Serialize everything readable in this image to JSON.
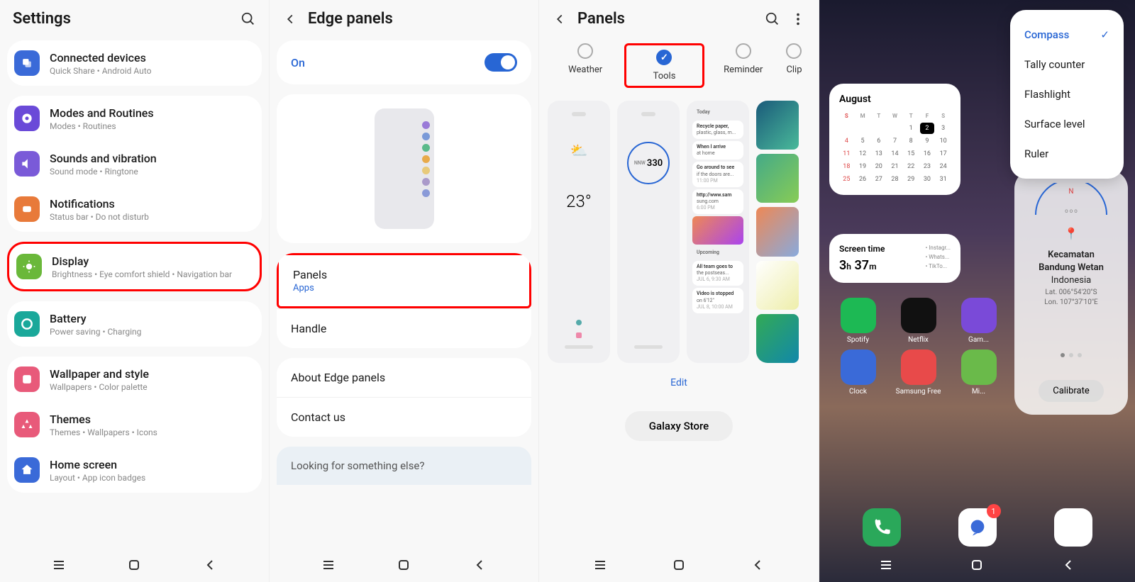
{
  "screen1": {
    "title": "Settings",
    "items": [
      {
        "title": "Connected devices",
        "subtitle": "Quick Share • Android Auto",
        "icon": "link-icon",
        "color": "#3a6ad8"
      },
      {
        "title": "Modes and Routines",
        "subtitle": "Modes • Routines",
        "icon": "modes-icon",
        "color": "#6a4ad8"
      },
      {
        "title": "Sounds and vibration",
        "subtitle": "Sound mode • Ringtone",
        "icon": "sound-icon",
        "color": "#7a5ad8"
      },
      {
        "title": "Notifications",
        "subtitle": "Status bar • Do not disturb",
        "icon": "notif-icon",
        "color": "#e87a3a"
      },
      {
        "title": "Display",
        "subtitle": "Brightness • Eye comfort shield • Navigation bar",
        "icon": "display-icon",
        "color": "#6ab83a"
      },
      {
        "title": "Battery",
        "subtitle": "Power saving • Charging",
        "icon": "battery-icon",
        "color": "#1aa89a"
      },
      {
        "title": "Wallpaper and style",
        "subtitle": "Wallpapers • Color palette",
        "icon": "wallpaper-icon",
        "color": "#e85a7a"
      },
      {
        "title": "Themes",
        "subtitle": "Themes • Wallpapers • Icons",
        "icon": "themes-icon",
        "color": "#e85a7a"
      },
      {
        "title": "Home screen",
        "subtitle": "Layout • App icon badges",
        "icon": "home-icon",
        "color": "#3a6ad8"
      }
    ]
  },
  "screen2": {
    "title": "Edge panels",
    "toggle_label": "On",
    "items": [
      {
        "title": "Panels",
        "sub": "Apps"
      },
      {
        "title": "Handle"
      },
      {
        "title": "About Edge panels"
      },
      {
        "title": "Contact us"
      }
    ],
    "footer": "Looking for something else?"
  },
  "screen3": {
    "title": "Panels",
    "tabs": [
      {
        "label": "Weather",
        "checked": false
      },
      {
        "label": "Tools",
        "checked": true
      },
      {
        "label": "Reminder",
        "checked": false
      },
      {
        "label": "Clip",
        "checked": false
      }
    ],
    "weather_temp": "23°",
    "compass_val": "330",
    "compass_prefix": "NNW",
    "reminders": [
      {
        "title": "Today"
      },
      {
        "title": "Recycle paper,",
        "sub": "plastic, glass, m..."
      },
      {
        "title": "When I arrive",
        "sub": "at home"
      },
      {
        "title": "Go around to see",
        "sub": "if the doors are...",
        "time": "11:00 PM"
      },
      {
        "title": "http://www.sam",
        "sub": "sung.com",
        "time": "6:00 PM"
      },
      {
        "title": "Upcoming"
      },
      {
        "title": "All team goes to",
        "sub": "the postseas...",
        "time": "JUL 6, 9:30 AM"
      },
      {
        "title": "Video is stopped",
        "sub": "on 6'12\"",
        "time": "JUL 8, 10:00 AM"
      }
    ],
    "edit": "Edit",
    "store": "Galaxy Store"
  },
  "screen4": {
    "menu": [
      {
        "label": "Compass",
        "selected": true
      },
      {
        "label": "Tally counter"
      },
      {
        "label": "Flashlight"
      },
      {
        "label": "Surface level"
      },
      {
        "label": "Ruler"
      }
    ],
    "cal": {
      "month": "August",
      "dow": [
        "S",
        "M",
        "T",
        "W",
        "T",
        "F",
        "S"
      ],
      "days": [
        [
          "",
          "",
          "",
          "1",
          "2",
          "3"
        ],
        [
          "4",
          "5",
          "6",
          "7",
          "8",
          "9",
          "10"
        ],
        [
          "11",
          "12",
          "13",
          "14",
          "15",
          "16",
          "17"
        ],
        [
          "18",
          "19",
          "20",
          "21",
          "22",
          "23",
          "24"
        ],
        [
          "25",
          "26",
          "27",
          "28",
          "29",
          "30",
          "31"
        ]
      ],
      "today": "2"
    },
    "screentime": {
      "label": "Screen time",
      "value_h": "3",
      "value_m": "37",
      "legend": [
        "Instagr...",
        "Whats...",
        "TikTo..."
      ]
    },
    "location": {
      "line1": "Kecamatan",
      "line2": "Bandung Wetan",
      "country": "Indonesia",
      "lat": "Lat. 006°54'20\"S",
      "lon": "Lon. 107°37'10\"E"
    },
    "calibrate": "Calibrate",
    "apps": [
      {
        "label": "Spotify",
        "color": "#1db954"
      },
      {
        "label": "Netflix",
        "color": "#111"
      },
      {
        "label": "Gam...",
        "color": "#7a4ad8"
      },
      {
        "label": "Clock",
        "color": "#3a6ad8"
      },
      {
        "label": "Samsung Free",
        "color": "#e84a4a"
      },
      {
        "label": "Mi...",
        "color": "#6aba4a"
      }
    ],
    "dock_badge": "1"
  }
}
